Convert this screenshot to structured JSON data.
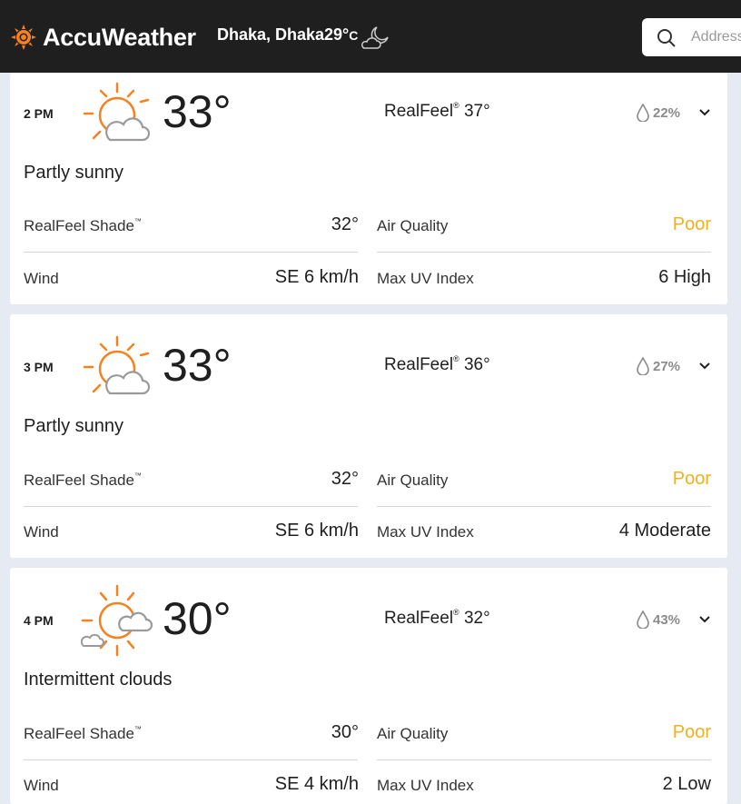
{
  "header": {
    "brand": "AccuWeather",
    "location": "Dhaka, Dhaka",
    "current_temp": "29°",
    "current_unit": "C",
    "search_placeholder": "Address"
  },
  "colors": {
    "header_bg": "#1f1f1f",
    "accent_orange": "#f58220",
    "air_quality_poor": "#f0b11c",
    "page_bg": "#e6eaf2"
  },
  "labels": {
    "realfeel": "RealFeel",
    "realfeel_shade": "RealFeel Shade",
    "air_quality": "Air Quality",
    "wind": "Wind",
    "max_uv": "Max UV Index",
    "trademark": "®",
    "tm": "™"
  },
  "hours": [
    {
      "time": "2 PM",
      "icon": "partly-sunny-icon",
      "temp": "33°",
      "realfeel": "37°",
      "precip": "22%",
      "phrase": "Partly sunny",
      "realfeel_shade": "32°",
      "air_quality": "Poor",
      "wind": "SE 6 km/h",
      "max_uv": "6 High"
    },
    {
      "time": "3 PM",
      "icon": "partly-sunny-icon",
      "temp": "33°",
      "realfeel": "36°",
      "precip": "27%",
      "phrase": "Partly sunny",
      "realfeel_shade": "32°",
      "air_quality": "Poor",
      "wind": "SE 6 km/h",
      "max_uv": "4 Moderate"
    },
    {
      "time": "4 PM",
      "icon": "intermittent-clouds-icon",
      "temp": "30°",
      "realfeel": "32°",
      "precip": "43%",
      "phrase": "Intermittent clouds",
      "realfeel_shade": "30°",
      "air_quality": "Poor",
      "wind": "SE 4 km/h",
      "max_uv": "2 Low"
    }
  ]
}
